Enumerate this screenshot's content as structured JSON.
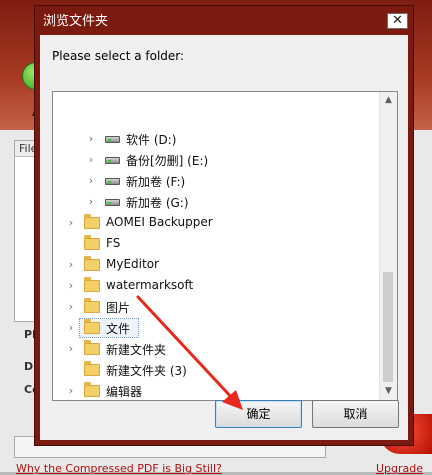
{
  "dialog": {
    "title": "浏览文件夹",
    "close_glyph": "✕",
    "prompt": "Please select a folder:",
    "ok_label": "确定",
    "cancel_label": "取消"
  },
  "tree": {
    "items": [
      {
        "label": "软件 (D:)",
        "kind": "drive",
        "level": 2
      },
      {
        "label": "备份[勿删] (E:)",
        "kind": "drive",
        "level": 2
      },
      {
        "label": "新加卷 (F:)",
        "kind": "drive",
        "level": 2
      },
      {
        "label": "新加卷 (G:)",
        "kind": "drive",
        "level": 2
      },
      {
        "label": "AOMEI Backupper",
        "kind": "folder",
        "level": 1,
        "expandable": true
      },
      {
        "label": "FS",
        "kind": "folder",
        "level": 1,
        "expandable": false
      },
      {
        "label": "MyEditor",
        "kind": "folder",
        "level": 1,
        "expandable": true
      },
      {
        "label": "watermarksoft",
        "kind": "folder",
        "level": 1,
        "expandable": true
      },
      {
        "label": "图片",
        "kind": "folder",
        "level": 1,
        "expandable": true
      },
      {
        "label": "文件",
        "kind": "folder",
        "level": 1,
        "expandable": true,
        "selected": true
      },
      {
        "label": "新建文件夹",
        "kind": "folder",
        "level": 1,
        "expandable": true
      },
      {
        "label": "新建文件夹 (3)",
        "kind": "folder",
        "level": 1,
        "expandable": false
      },
      {
        "label": "编辑器",
        "kind": "folder",
        "level": 1,
        "expandable": true
      }
    ]
  },
  "background_app": {
    "list_header": "File",
    "label_1": "PD",
    "label_2": "DR",
    "label_3": "Co",
    "side_letter": "A",
    "link_left": "Why the Compressed PDF is Big Still?",
    "link_right": "Upgrade"
  },
  "colors": {
    "dialog_frame": "#7b1a0e",
    "annotation_arrow": "#e8281c"
  }
}
